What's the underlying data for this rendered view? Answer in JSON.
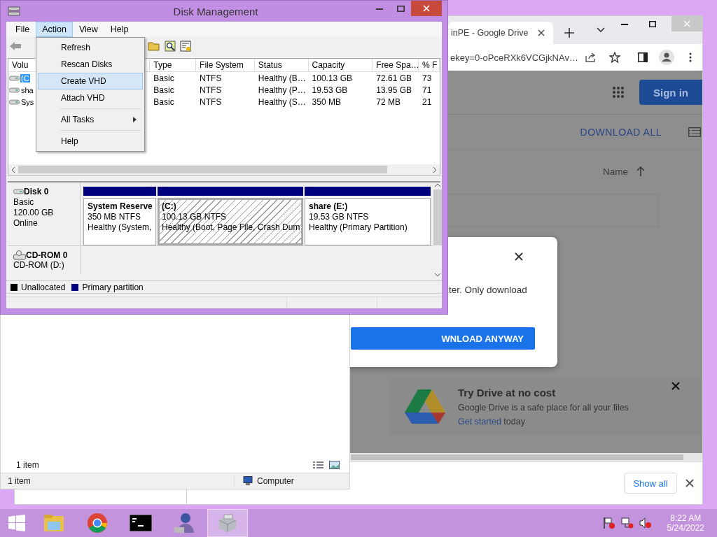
{
  "disk_management": {
    "title": "Disk Management",
    "menu": [
      {
        "label": "File",
        "selected": false
      },
      {
        "label": "Action",
        "selected": true
      },
      {
        "label": "View",
        "selected": false
      },
      {
        "label": "Help",
        "selected": false
      }
    ],
    "action_menu": [
      {
        "kind": "item",
        "label": "Refresh",
        "selected": false
      },
      {
        "kind": "item",
        "label": "Rescan Disks",
        "selected": false
      },
      {
        "kind": "item",
        "label": "Create VHD",
        "selected": true
      },
      {
        "kind": "item",
        "label": "Attach VHD",
        "selected": false
      },
      {
        "kind": "separator"
      },
      {
        "kind": "submenu",
        "label": "All Tasks",
        "selected": false
      },
      {
        "kind": "separator"
      },
      {
        "kind": "item",
        "label": "Help",
        "selected": false
      }
    ],
    "columns": [
      "Volu",
      "Type",
      "File System",
      "Status",
      "Capacity",
      "Free Spa…",
      "% F"
    ],
    "rows": [
      {
        "selected": true,
        "cells": [
          "(C",
          "Basic",
          "NTFS",
          "Healthy (B…",
          "100.13 GB",
          "72.61 GB",
          "73"
        ]
      },
      {
        "selected": false,
        "cells": [
          "sha",
          "Basic",
          "NTFS",
          "Healthy (P…",
          "19.53 GB",
          "13.95 GB",
          "71"
        ]
      },
      {
        "selected": false,
        "cells": [
          "Sys",
          "Basic",
          "NTFS",
          "Healthy (S…",
          "350 MB",
          "72 MB",
          "21"
        ]
      }
    ],
    "disk": {
      "name": "Disk 0",
      "type": "Basic",
      "size": "120.00 GB",
      "status": "Online",
      "partitions": [
        {
          "name": "System Reserve",
          "size": "350 MB NTFS",
          "status": "Healthy (System,",
          "selected": false
        },
        {
          "name": "(C:)",
          "size": "100.13 GB NTFS",
          "status": "Healthy (Boot, Page File, Crash Dum",
          "selected": true
        },
        {
          "name": "share  (E:)",
          "size": "19.53 GB NTFS",
          "status": "Healthy (Primary Partition)",
          "selected": false
        }
      ]
    },
    "cdrom": {
      "name": "CD-ROM 0",
      "drive": "CD-ROM (D:)"
    },
    "legend": [
      {
        "label": "Unallocated",
        "color": "#000000"
      },
      {
        "label": "Primary partition",
        "color": "#00007f"
      }
    ]
  },
  "chrome": {
    "tab_title": "inPE - Google Drive",
    "url": "ekey=0-oPceRXk6VCGjkNAv…",
    "sign_in": "Sign in",
    "download_all": "DOWNLOAD ALL",
    "sort_label": "Name",
    "dialog": {
      "text": "ter. Only download",
      "button": "WNLOAD ANYWAY"
    },
    "promo": {
      "title": "Try Drive at no cost",
      "text": "Google Drive is a safe place for all your files",
      "link": "Get started",
      "link_suffix": "today"
    },
    "show_all": "Show all"
  },
  "explorer": {
    "item_count": "1 item",
    "status": "1 item",
    "location": "Computer"
  },
  "taskbar": {
    "apps": [
      {
        "kind": "explorer",
        "active": false
      },
      {
        "kind": "chrome",
        "active": false
      },
      {
        "kind": "terminal",
        "active": false
      },
      {
        "kind": "person",
        "active": false
      },
      {
        "kind": "disk",
        "active": true
      }
    ],
    "time": "8:22 AM",
    "date": "5/24/2022"
  }
}
